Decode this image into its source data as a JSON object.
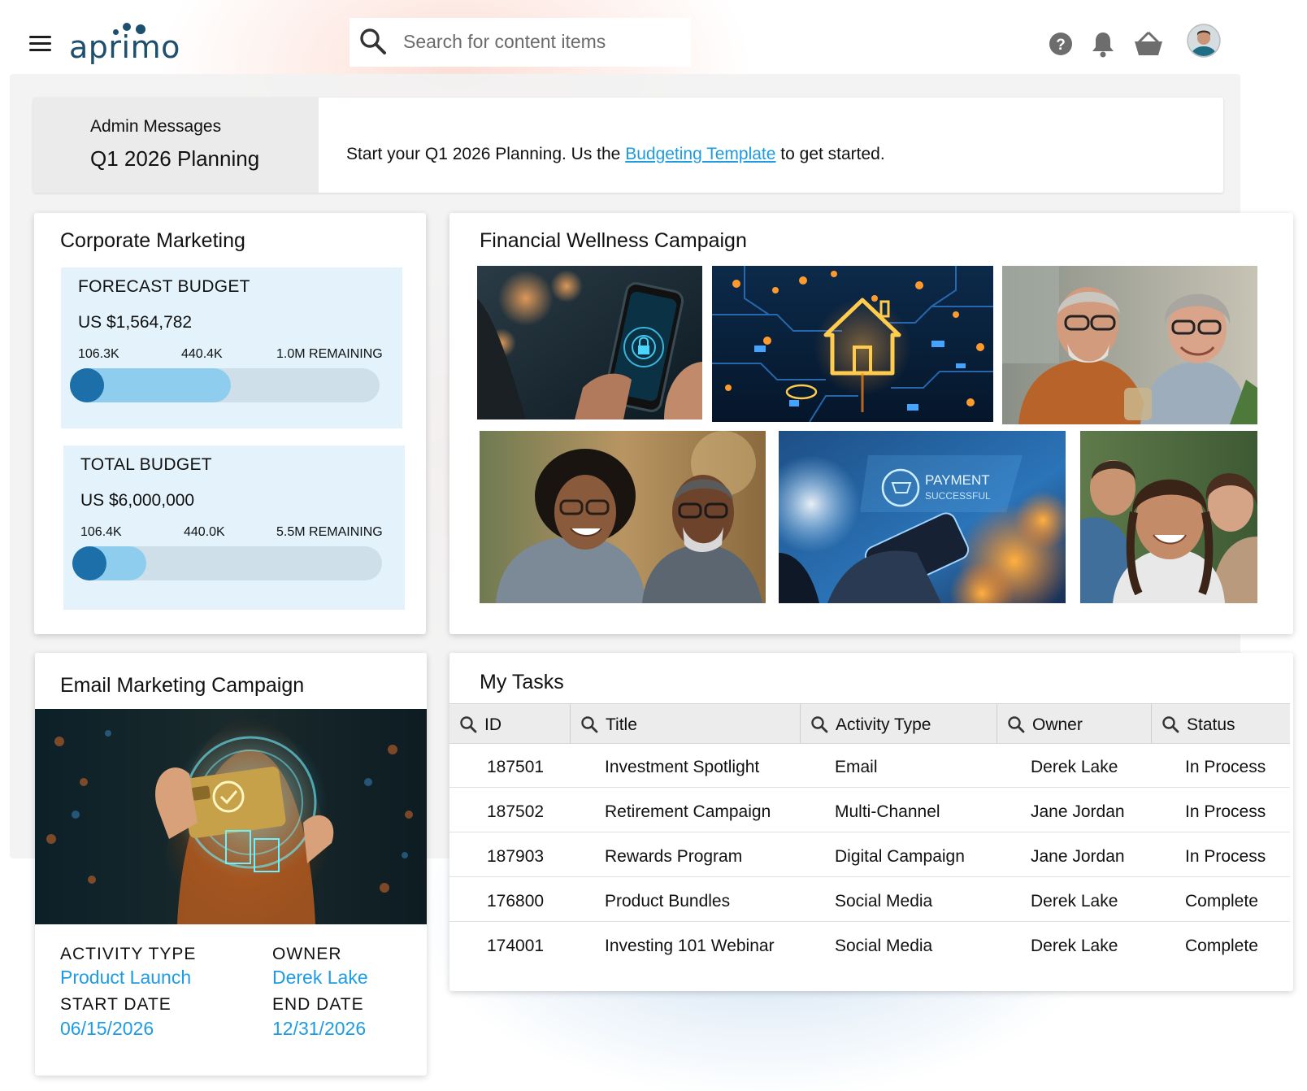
{
  "header": {
    "logo_text": "aprimo",
    "search_placeholder": "Search for content items",
    "icons": [
      "menu-icon",
      "search-icon",
      "help-icon",
      "bell-icon",
      "basket-icon",
      "avatar"
    ]
  },
  "admin": {
    "label": "Admin Messages",
    "title": "Q1 2026 Planning",
    "message_before": "Start your Q1 2026 Planning. Us the ",
    "link_text": "Budgeting Template",
    "message_after": " to get started."
  },
  "corporate_marketing": {
    "title": "Corporate Marketing",
    "forecast": {
      "label": "FORECAST BUDGET",
      "amount": "US $1,564,782",
      "tick_1": "106.3K",
      "tick_2": "440.4K",
      "remaining": "1.0M REMAINING",
      "spent_fraction": 0.068,
      "committed_fraction": 0.52
    },
    "total": {
      "label": "TOTAL BUDGET",
      "amount": "US $6,000,000",
      "tick_1": "106.4K",
      "tick_2": "440.0K",
      "remaining": "5.5M REMAINING",
      "spent_fraction": 0.018,
      "committed_fraction": 0.24
    }
  },
  "financial_wellness": {
    "title": "Financial Wellness Campaign",
    "images": [
      "phone-security-image",
      "smart-home-circuit-image",
      "senior-couple-image",
      "smiling-couple-image",
      "payment-successful-image",
      "family-selfie-image"
    ],
    "payment_text_1": "PAYMENT",
    "payment_text_2": "SUCCESSFUL"
  },
  "email_campaign": {
    "title": "Email Marketing Campaign",
    "activity_type_label": "ACTIVITY TYPE",
    "activity_type": "Product Launch",
    "owner_label": "OWNER",
    "owner": "Derek Lake",
    "start_date_label": "START DATE",
    "start_date": "06/15/2026",
    "end_date_label": "END DATE",
    "end_date": "12/31/2026"
  },
  "tasks": {
    "title": "My Tasks",
    "columns": [
      "ID",
      "Title",
      "Activity Type",
      "Owner",
      "Status"
    ],
    "rows": [
      {
        "id": "187501",
        "title": "Investment Spotlight",
        "activity_type": "Email",
        "owner": "Derek Lake",
        "status": "In Process"
      },
      {
        "id": "187502",
        "title": "Retirement Campaign",
        "activity_type": "Multi-Channel",
        "owner": "Jane Jordan",
        "status": "In Process"
      },
      {
        "id": "187903",
        "title": "Rewards Program",
        "activity_type": "Digital Campaign",
        "owner": "Jane Jordan",
        "status": "In Process"
      },
      {
        "id": "176800",
        "title": "Product Bundles",
        "activity_type": "Social Media",
        "owner": "Derek Lake",
        "status": "Complete"
      },
      {
        "id": "174001",
        "title": "Investing 101 Webinar",
        "activity_type": "Social Media",
        "owner": "Derek Lake",
        "status": "Complete"
      }
    ]
  },
  "colors": {
    "brand": "#1d4f6e",
    "link": "#1d9be3",
    "bar_knob": "#1c6fa8",
    "bar_fill": "#8fcdee",
    "panel_bg": "#e3f2fb"
  }
}
